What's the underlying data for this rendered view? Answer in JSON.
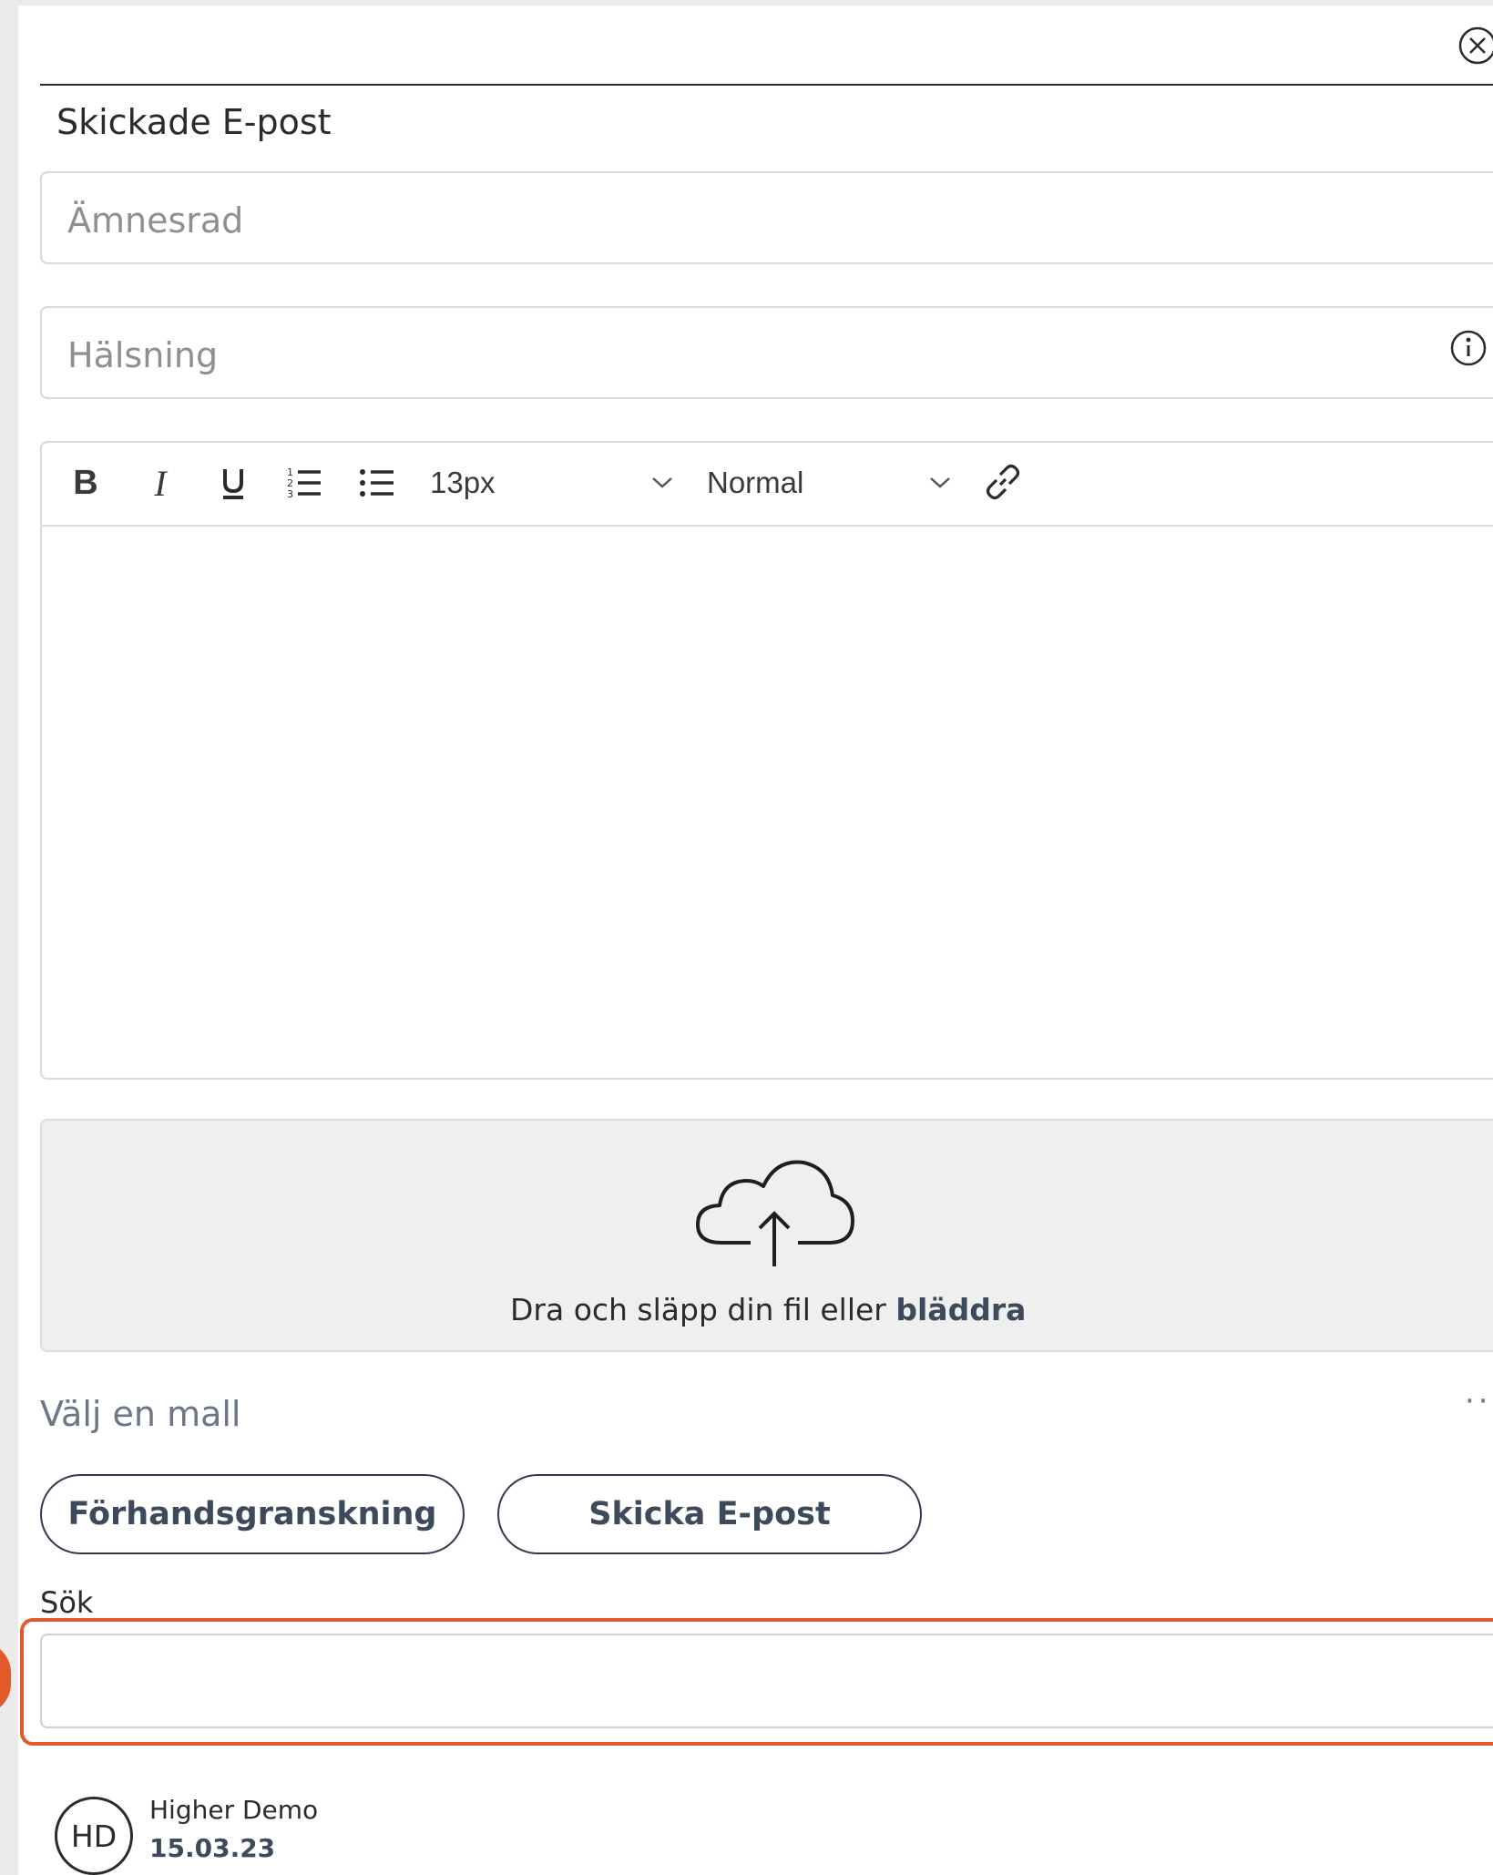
{
  "panel": {
    "title": "Skickade E-post"
  },
  "form": {
    "subject_placeholder": "Ämnesrad",
    "greeting_placeholder": "Hälsning"
  },
  "toolbar": {
    "bold_label": "B",
    "italic_label": "I",
    "underline_label": "U",
    "font_size_value": "13px",
    "style_value": "Normal"
  },
  "dropzone": {
    "text": "Dra och släpp din fil eller",
    "browse_link": "bläddra"
  },
  "template": {
    "label": "Välj en mall",
    "more": "··"
  },
  "actions": {
    "preview_label": "Förhandsgranskning",
    "send_label": "Skicka E-post"
  },
  "search": {
    "label": "Sök",
    "value": ""
  },
  "history": [
    {
      "avatar_initials": "HD",
      "author": "Higher Demo",
      "date": "15.03.23"
    }
  ],
  "colors": {
    "highlight": "#e2592a",
    "accent_text": "#3d4a5c"
  }
}
